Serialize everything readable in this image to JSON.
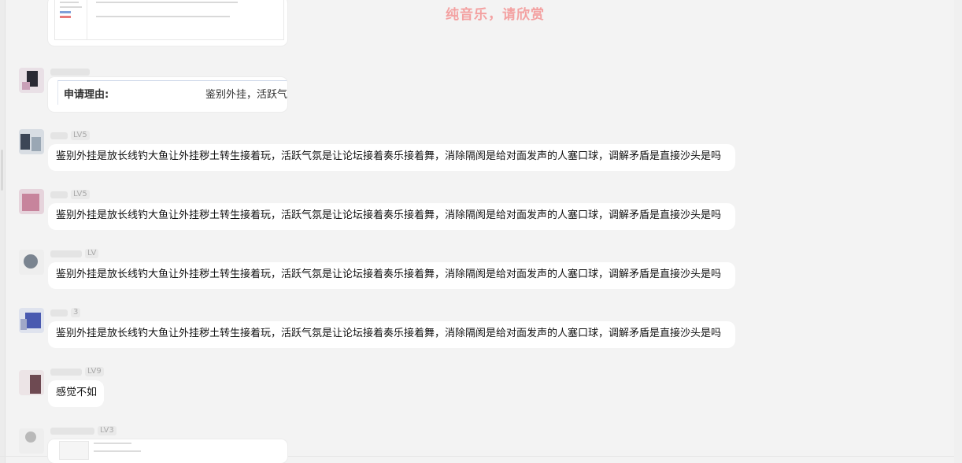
{
  "overlay_caption": "纯音乐，请欣赏",
  "messages": {
    "top_image": {
      "kind": "image"
    },
    "reason_card": {
      "label": "申请理由:",
      "value": "鉴别外挂，活跃气氛"
    },
    "m1": {
      "level": "LV5",
      "text": "鉴别外挂是放长线钓大鱼让外挂秽土转生接着玩，活跃气氛是让论坛接着奏乐接着舞，消除隔阂是给对面发声的人塞口球，调解矛盾是直接沙头是吗"
    },
    "m2": {
      "level": "LV5",
      "text": "鉴别外挂是放长线钓大鱼让外挂秽土转生接着玩，活跃气氛是让论坛接着奏乐接着舞，消除隔阂是给对面发声的人塞口球，调解矛盾是直接沙头是吗"
    },
    "m3": {
      "level": "LV",
      "text": "鉴别外挂是放长线钓大鱼让外挂秽土转生接着玩，活跃气氛是让论坛接着奏乐接着舞，消除隔阂是给对面发声的人塞口球，调解矛盾是直接沙头是吗"
    },
    "m4": {
      "level": "3",
      "text": "鉴别外挂是放长线钓大鱼让外挂秽土转生接着玩，活跃气氛是让论坛接着奏乐接着舞，消除隔阂是给对面发声的人塞口球，调解矛盾是直接沙头是吗"
    },
    "m5": {
      "level": "LV9",
      "text": "感觉不如"
    },
    "m6": {
      "level": "LV3",
      "kind": "image"
    }
  }
}
